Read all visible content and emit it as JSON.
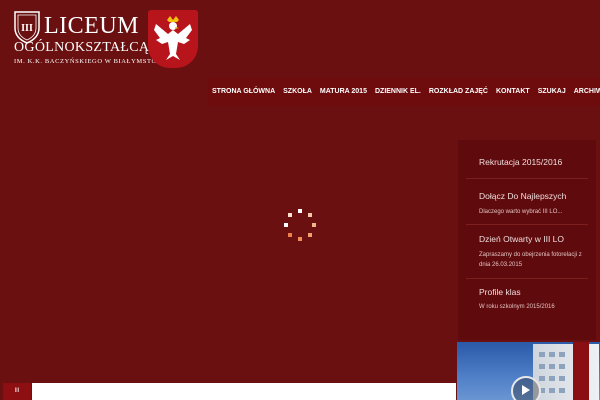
{
  "logo": {
    "title": "LICEUM",
    "subtitle": "OGÓLNOKSZTAŁCĄCE",
    "patron": "IM. K.K. BACZYŃSKIEGO W BIAŁYMSTOKU",
    "crest_numeral": "III"
  },
  "nav": {
    "items": [
      {
        "label": "STRONA GŁÓWNA"
      },
      {
        "label": "SZKOŁA"
      },
      {
        "label": "MATURA 2015"
      },
      {
        "label": "DZIENNIK EL."
      },
      {
        "label": "ROZKŁAD ZAJĘĆ"
      },
      {
        "label": "KONTAKT"
      },
      {
        "label": "SZUKAJ"
      },
      {
        "label": "ARCHIWUM"
      }
    ]
  },
  "sidebar": {
    "items": [
      {
        "title": "Rekrutacja 2015/2016",
        "sub": ""
      },
      {
        "title": "Dołącz Do Najlepszych",
        "sub": "Dlaczego warto wybrać III LO..."
      },
      {
        "title": "Dzień Otwarty w III LO",
        "sub": "Zapraszamy do obejrzenia fotorelacji z dnia 26.03.2015"
      },
      {
        "title": "Profile klas",
        "sub": "W roku szkolnym 2015/2016"
      }
    ]
  },
  "badge": {
    "label": "III"
  },
  "colors": {
    "background": "#6a1010",
    "nav": "#6d0b0d",
    "sidebar": "#5f0a0c",
    "accent_red": "#b8141b"
  }
}
